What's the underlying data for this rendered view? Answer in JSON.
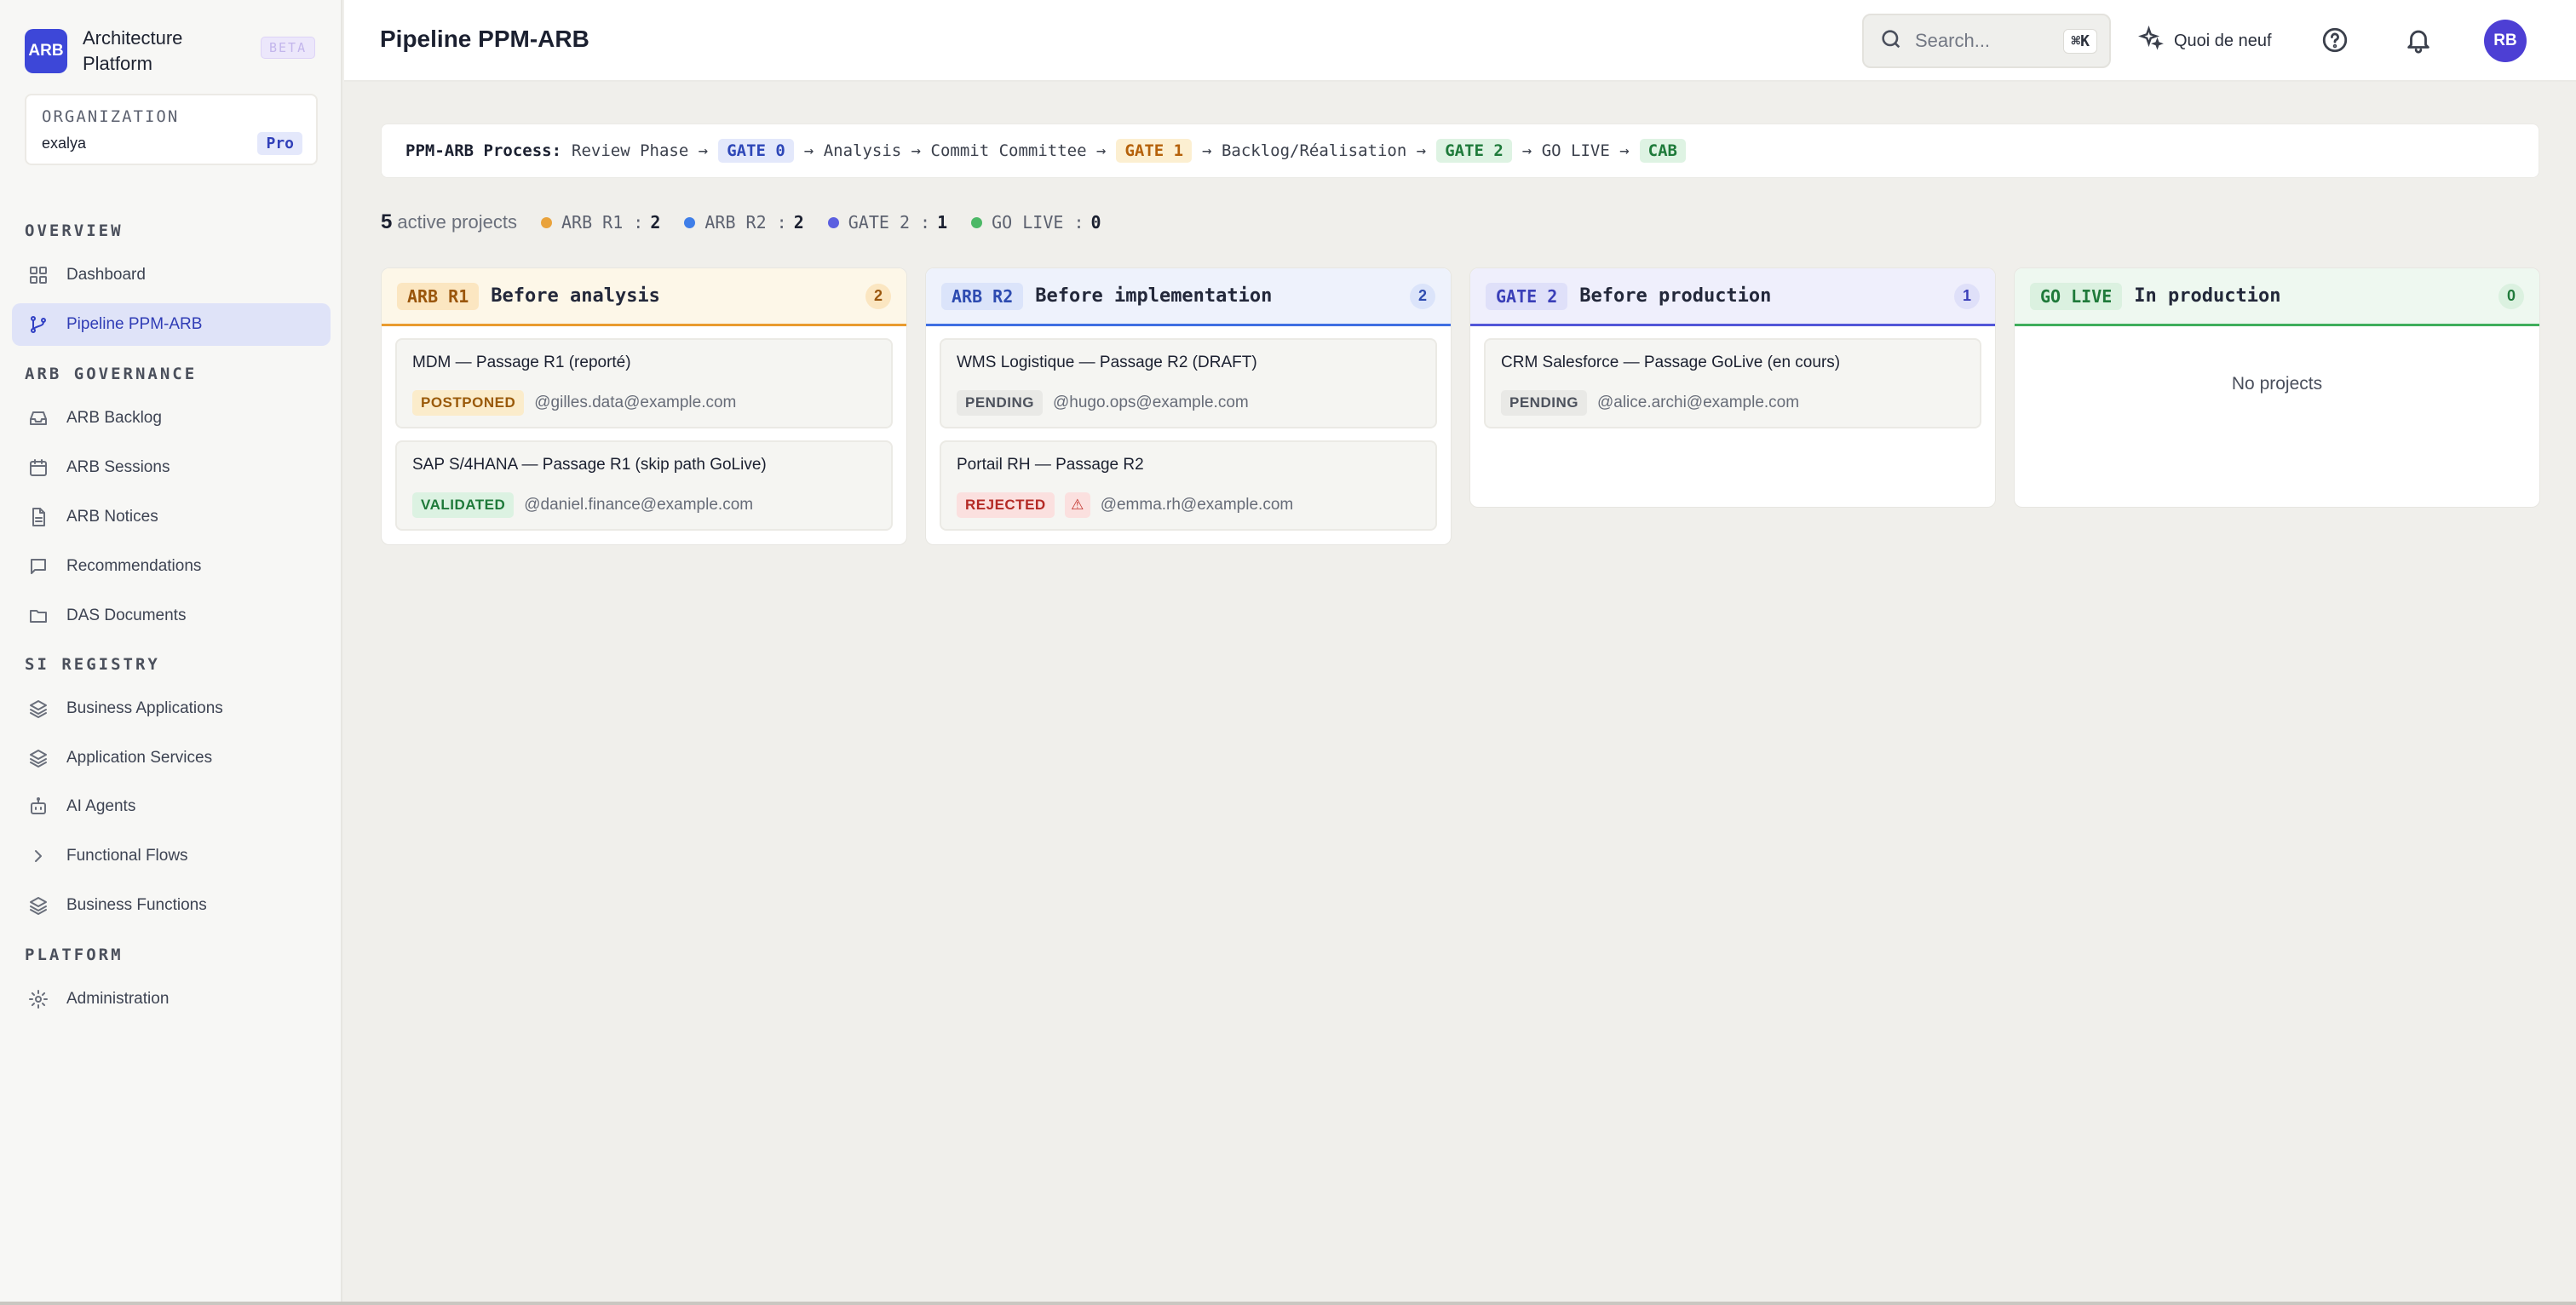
{
  "sidebar": {
    "brand": {
      "logo": "ARB",
      "name": "Architecture Platform",
      "badge": "BETA"
    },
    "org": {
      "label": "ORGANIZATION",
      "name": "exalya",
      "plan": "Pro"
    },
    "sections": [
      {
        "title": "OVERVIEW",
        "items": [
          {
            "label": "Dashboard",
            "icon": "grid-icon"
          },
          {
            "label": "Pipeline PPM-ARB",
            "icon": "git-branch-icon",
            "active": true
          }
        ]
      },
      {
        "title": "ARB GOVERNANCE",
        "items": [
          {
            "label": "ARB Backlog",
            "icon": "inbox-icon"
          },
          {
            "label": "ARB Sessions",
            "icon": "calendar-icon"
          },
          {
            "label": "ARB Notices",
            "icon": "file-text-icon"
          },
          {
            "label": "Recommendations",
            "icon": "message-square-icon"
          },
          {
            "label": "DAS Documents",
            "icon": "folder-icon"
          }
        ]
      },
      {
        "title": "SI REGISTRY",
        "items": [
          {
            "label": "Business Applications",
            "icon": "layers-icon"
          },
          {
            "label": "Application Services",
            "icon": "layers-icon"
          },
          {
            "label": "AI Agents",
            "icon": "bot-icon"
          },
          {
            "label": "Functional Flows",
            "icon": "chevron-right-icon"
          },
          {
            "label": "Business Functions",
            "icon": "layers-icon"
          }
        ]
      },
      {
        "title": "PLATFORM",
        "items": [
          {
            "label": "Administration",
            "icon": "gear-icon"
          }
        ]
      }
    ]
  },
  "header": {
    "title": "Pipeline PPM-ARB",
    "search_placeholder": "Search...",
    "search_shortcut": "⌘K",
    "whats_new": "Quoi de neuf",
    "avatar_initials": "RB"
  },
  "process": {
    "label": "PPM-ARB Process:",
    "review": "Review Phase →",
    "gate0": "GATE 0",
    "analysis": "→ Analysis → Commit Committee →",
    "gate1": "GATE 1",
    "backlog": "→ Backlog/Réalisation →",
    "gate2": "GATE 2",
    "golive": "→ GO LIVE →",
    "cab": "CAB"
  },
  "stats": {
    "count": "5",
    "label": "active projects",
    "items": [
      {
        "label": "ARB R1 :",
        "value": "2",
        "color": "#e9a23b"
      },
      {
        "label": "ARB R2 :",
        "value": "2",
        "color": "#3f7ee8"
      },
      {
        "label": "GATE 2 :",
        "value": "1",
        "color": "#5b5fe0"
      },
      {
        "label": "GO LIVE :",
        "value": "0",
        "color": "#4cb866"
      }
    ]
  },
  "columns": [
    {
      "tag": "ARB R1",
      "title": "Before analysis",
      "count": "2",
      "accent": "#e99b2f",
      "cards": [
        {
          "title": "MDM — Passage R1 (reporté)",
          "status": "POSTPONED",
          "owner": "@gilles.data@example.com"
        },
        {
          "title": "SAP S/4HANA — Passage R1 (skip path GoLive)",
          "status": "VALIDATED",
          "owner": "@daniel.finance@example.com"
        }
      ]
    },
    {
      "tag": "ARB R2",
      "title": "Before implementation",
      "count": "2",
      "accent": "#3f6fe2",
      "cards": [
        {
          "title": "WMS Logistique — Passage R2 (DRAFT)",
          "status": "PENDING",
          "owner": "@hugo.ops@example.com"
        },
        {
          "title": "Portail RH — Passage R2",
          "status": "REJECTED",
          "warning": "⚠",
          "owner": "@emma.rh@example.com"
        }
      ]
    },
    {
      "tag": "GATE 2",
      "title": "Before production",
      "count": "1",
      "accent": "#5256d8",
      "cards": [
        {
          "title": "CRM Salesforce — Passage GoLive (en cours)",
          "status": "PENDING",
          "owner": "@alice.archi@example.com"
        }
      ]
    },
    {
      "tag": "GO LIVE",
      "title": "In production",
      "count": "0",
      "accent": "#3fae5c",
      "empty": "No projects",
      "cards": []
    }
  ]
}
